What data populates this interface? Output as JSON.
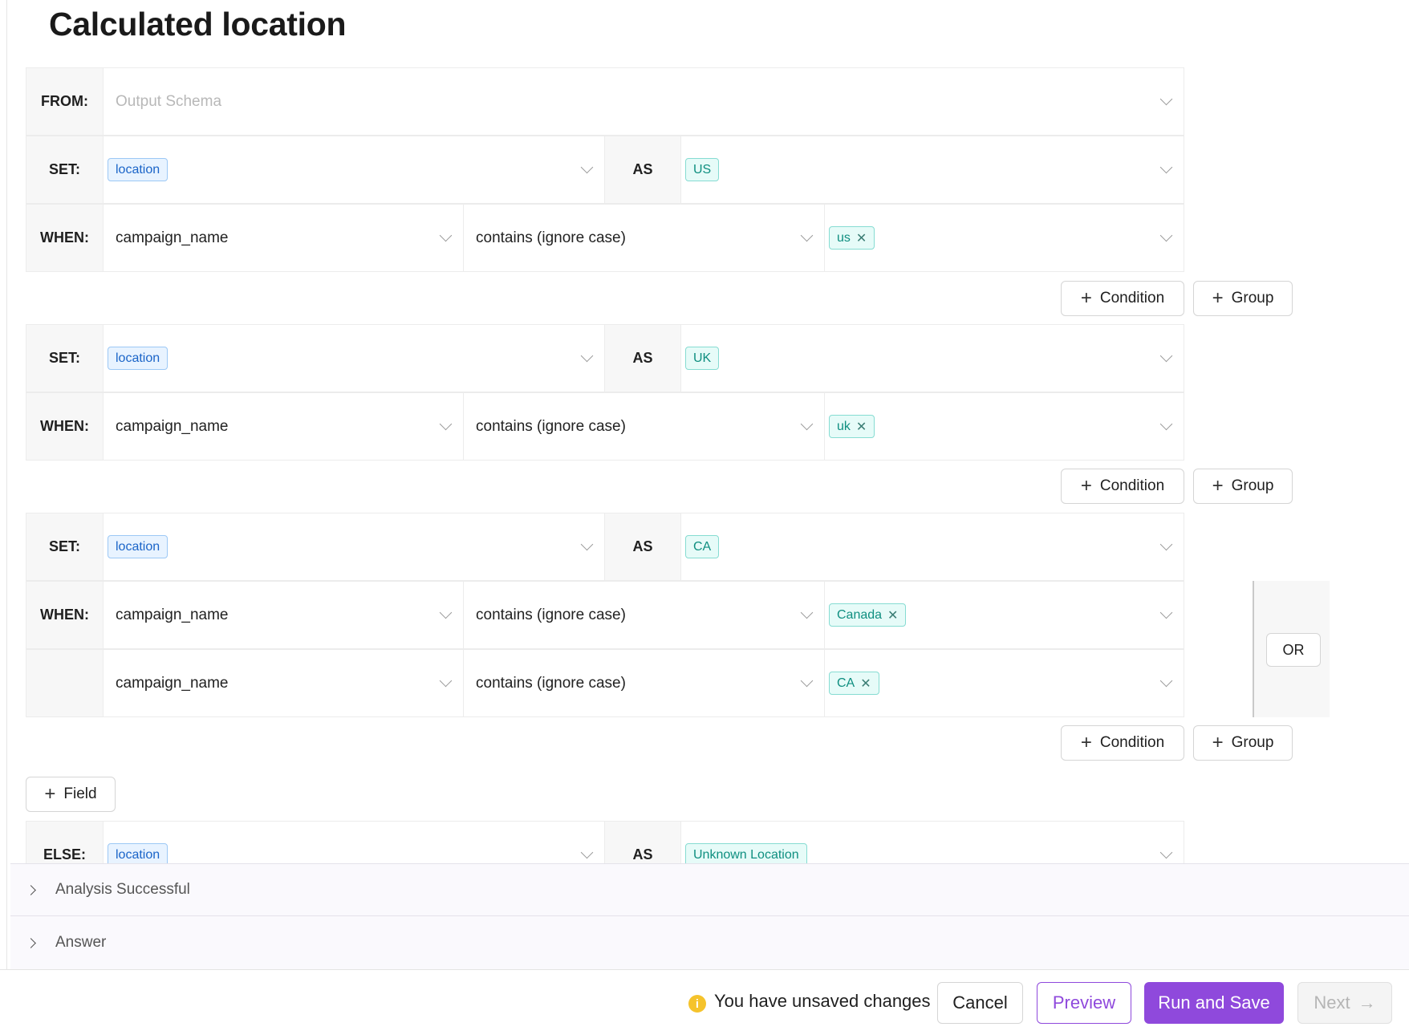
{
  "page": {
    "title": "Calculated location"
  },
  "from": {
    "label": "FROM:",
    "placeholder": "Output Schema"
  },
  "labels": {
    "set": "SET:",
    "when": "WHEN:",
    "as": "AS",
    "else": "ELSE:"
  },
  "blocks": [
    {
      "set_field": "location",
      "as_value": "US",
      "conditions": [
        {
          "field": "campaign_name",
          "operator": "contains (ignore case)",
          "value": "us"
        }
      ]
    },
    {
      "set_field": "location",
      "as_value": "UK",
      "conditions": [
        {
          "field": "campaign_name",
          "operator": "contains (ignore case)",
          "value": "uk"
        }
      ]
    },
    {
      "set_field": "location",
      "as_value": "CA",
      "group_operator": "OR",
      "conditions": [
        {
          "field": "campaign_name",
          "operator": "contains (ignore case)",
          "value": "Canada"
        },
        {
          "field": "campaign_name",
          "operator": "contains (ignore case)",
          "value": "CA"
        }
      ]
    }
  ],
  "buttons": {
    "add_condition": "Condition",
    "add_group": "Group",
    "add_field": "Field"
  },
  "else_row": {
    "set_field": "location",
    "as_value": "Unknown Location"
  },
  "accordions": [
    {
      "label": "Analysis Successful"
    },
    {
      "label": "Answer"
    }
  ],
  "footer": {
    "warning_icon": "i",
    "unsaved_text": "You have unsaved changes",
    "cancel": "Cancel",
    "preview": "Preview",
    "run_and_save": "Run and Save",
    "next": "Next"
  },
  "colors": {
    "accent": "#8f49dc",
    "tag_blue": "#1a64c8",
    "tag_teal": "#0f8f80",
    "warning": "#f5c32c"
  },
  "icons": {
    "chevron": "chevron-down-icon",
    "plus": "plus-icon",
    "remove": "close-icon",
    "expand": "chevron-right-icon",
    "next": "arrow-right-icon"
  }
}
